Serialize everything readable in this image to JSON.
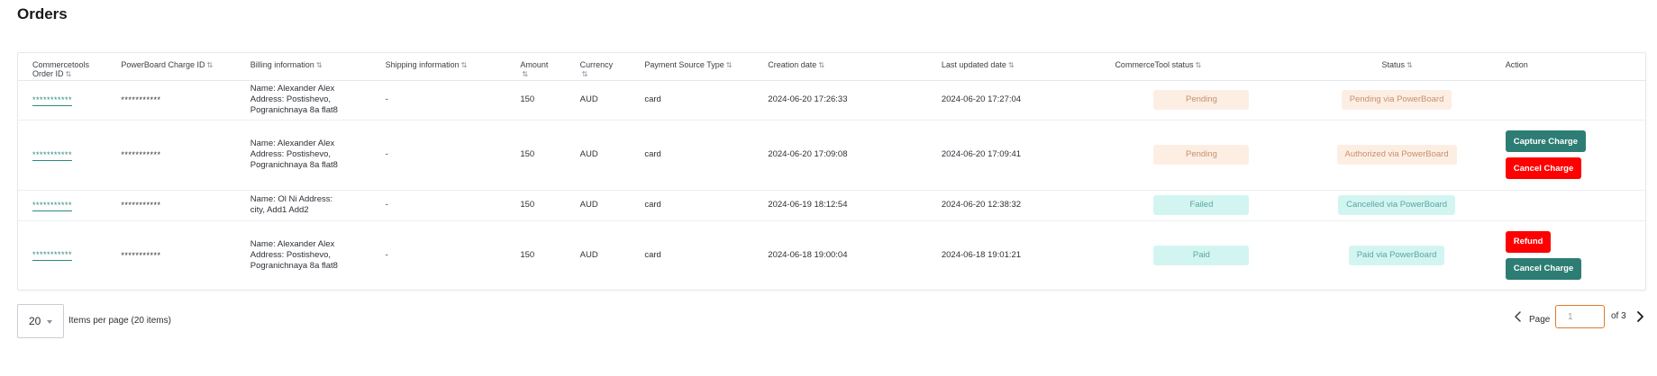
{
  "page": {
    "title": "Orders"
  },
  "table": {
    "headers": {
      "order_id_line1": "Commercetools",
      "order_id_line2": "Order ID",
      "charge_id": "PowerBoard Charge ID",
      "billing": "Billing information",
      "shipping": "Shipping information",
      "amount": "Amount",
      "currency": "Currency",
      "payment_source": "Payment Source Type",
      "creation": "Creation date",
      "updated": "Last updated date",
      "ct_status": "CommerceTool status",
      "status": "Status",
      "action": "Action"
    },
    "sort_icon": "sort-icon",
    "rows": [
      {
        "order_id": "***********",
        "charge_id": "***********",
        "billing_l1": "Name: Alexander Alex",
        "billing_l2": "Address: Postishevo,",
        "billing_l3": "Pogranichnaya 8a flat8",
        "shipping": "-",
        "amount": "150",
        "currency": "AUD",
        "payment_source": "card",
        "creation": "2024-06-20 17:26:33",
        "updated": "2024-06-20 17:27:04",
        "ct_status": "Pending",
        "status": "Pending via PowerBoard",
        "actions": []
      },
      {
        "order_id": "***********",
        "charge_id": "***********",
        "billing_l1": "Name: Alexander Alex",
        "billing_l2": "Address: Postishevo,",
        "billing_l3": "Pogranichnaya 8a flat8",
        "shipping": "-",
        "amount": "150",
        "currency": "AUD",
        "payment_source": "card",
        "creation": "2024-06-20 17:09:08",
        "updated": "2024-06-20 17:09:41",
        "ct_status": "Pending",
        "status": "Authorized via PowerBoard",
        "actions": [
          "Capture Charge",
          "Cancel Charge"
        ]
      },
      {
        "order_id": "***********",
        "charge_id": "***********",
        "billing_l1": "Name: Ol Ni Address:",
        "billing_l2": "city, Add1 Add2",
        "billing_l3": "",
        "shipping": "-",
        "amount": "150",
        "currency": "AUD",
        "payment_source": "card",
        "creation": "2024-06-19 18:12:54",
        "updated": "2024-06-20 12:38:32",
        "ct_status": "Failed",
        "status": "Cancelled via PowerBoard",
        "actions": []
      },
      {
        "order_id": "***********",
        "charge_id": "***********",
        "billing_l1": "Name: Alexander Alex",
        "billing_l2": "Address: Postishevo,",
        "billing_l3": "Pogranichnaya 8a flat8",
        "shipping": "-",
        "amount": "150",
        "currency": "AUD",
        "payment_source": "card",
        "creation": "2024-06-18 19:00:04",
        "updated": "2024-06-18 19:01:21",
        "ct_status": "Paid",
        "status": "Paid via PowerBoard",
        "actions": [
          "Refund",
          "Cancel Charge"
        ]
      }
    ]
  },
  "pagination": {
    "per_page_value": "20",
    "per_page_label": "Items per page (20 items)",
    "page_label": "Page",
    "page_value": "1",
    "of_label": "of 3"
  },
  "colors": {
    "primary_teal": "#2d7d74",
    "danger_red": "#ff0000",
    "link_teal": "#2a8a7d",
    "pending_bg": "#fdeee3",
    "teal_bg": "#d3f5f2",
    "focus_orange": "#e07a2a"
  }
}
